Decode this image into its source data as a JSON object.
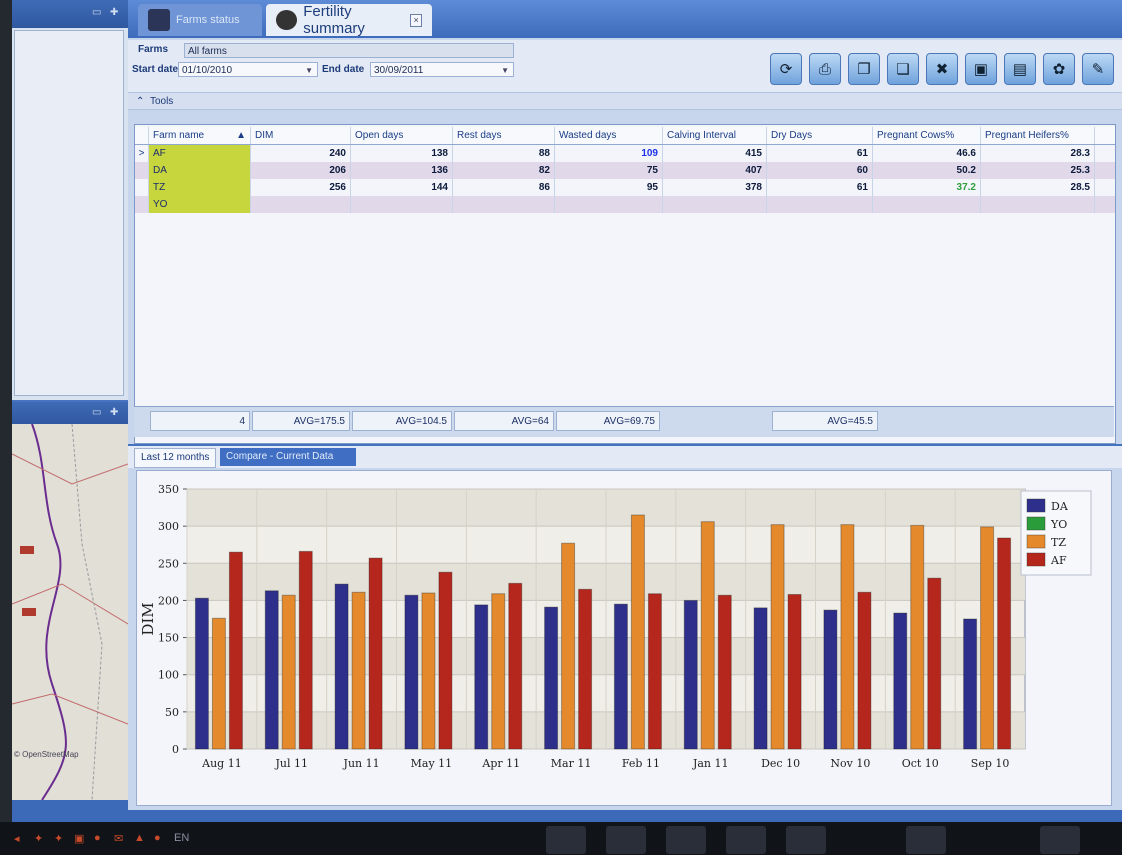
{
  "tabs": {
    "inactive": "Farms status",
    "active": "Fertility summary",
    "close": "×"
  },
  "filters": {
    "farms_label": "Farms",
    "farms_value": "All farms",
    "start_label": "Start date",
    "start_value": "01/10/2010",
    "end_label": "End date",
    "end_value": "30/09/2011"
  },
  "tools_label": "Tools",
  "tools_chevron": "⌃",
  "toolbar_icons": [
    "refresh-icon",
    "print-icon",
    "copy-icon",
    "paste-icon",
    "tools-icon",
    "export-icon",
    "save-icon",
    "settings-icon",
    "edit-icon"
  ],
  "grid": {
    "headers": [
      "Farm name",
      "DIM",
      "Open days",
      "Rest days",
      "Wasted days",
      "Calving Interval",
      "Dry Days",
      "Pregnant Cows%",
      "Pregnant Heifers%"
    ],
    "sort_indicator": "▲",
    "rows": [
      {
        "marker": ">",
        "farm": "AF",
        "dim": "240",
        "open": "138",
        "rest": "88",
        "wasted": "109",
        "calving": "415",
        "dry": "61",
        "preg_cows": "46.6",
        "preg_heifers": "28.3"
      },
      {
        "marker": "",
        "farm": "DA",
        "dim": "206",
        "open": "136",
        "rest": "82",
        "wasted": "75",
        "calving": "407",
        "dry": "60",
        "preg_cows": "50.2",
        "preg_heifers": "25.3"
      },
      {
        "marker": "",
        "farm": "TZ",
        "dim": "256",
        "open": "144",
        "rest": "86",
        "wasted": "95",
        "calving": "378",
        "dry": "61",
        "preg_cows": "37.2",
        "preg_heifers": "28.5"
      },
      {
        "marker": "",
        "farm": "YO",
        "dim": "",
        "open": "",
        "rest": "",
        "wasted": "",
        "calving": "",
        "dry": "",
        "preg_cows": "",
        "preg_heifers": ""
      }
    ],
    "footer": {
      "count": "4",
      "dim": "AVG=175.5",
      "open": "AVG=104.5",
      "rest": "AVG=64",
      "wasted": "AVG=69.75",
      "preg_cows": "AVG=45.5"
    }
  },
  "bottom_tabs": [
    "Last 12 months",
    "Compare - Current Data"
  ],
  "map_attribution": "© OpenStreetMap",
  "taskbar_lang": "EN",
  "colors": {
    "DA": "#2e2f8a",
    "YO": "#2a9c3a",
    "TZ": "#e58a2c",
    "AF": "#b5261c",
    "farm_cell": "#c8d63e"
  },
  "chart_data": {
    "type": "bar",
    "title": "",
    "xlabel": "",
    "ylabel": "DIM",
    "ylim": [
      0,
      350
    ],
    "yticks": [
      0,
      50,
      100,
      150,
      200,
      250,
      300,
      350
    ],
    "categories": [
      "Aug 11",
      "Jul 11",
      "Jun 11",
      "May 11",
      "Apr 11",
      "Mar 11",
      "Feb 11",
      "Jan 11",
      "Dec 10",
      "Nov 10",
      "Oct 10",
      "Sep 10"
    ],
    "legend_position": "right",
    "series": [
      {
        "name": "DA",
        "values": [
          203,
          213,
          222,
          207,
          194,
          191,
          195,
          200,
          190,
          187,
          183,
          175
        ]
      },
      {
        "name": "YO",
        "values": [
          null,
          null,
          null,
          null,
          null,
          null,
          null,
          null,
          null,
          null,
          null,
          null
        ]
      },
      {
        "name": "TZ",
        "values": [
          176,
          207,
          211,
          210,
          209,
          277,
          315,
          306,
          302,
          302,
          301,
          299
        ]
      },
      {
        "name": "AF",
        "values": [
          265,
          266,
          257,
          238,
          223,
          215,
          209,
          207,
          208,
          211,
          230,
          284
        ]
      }
    ]
  }
}
